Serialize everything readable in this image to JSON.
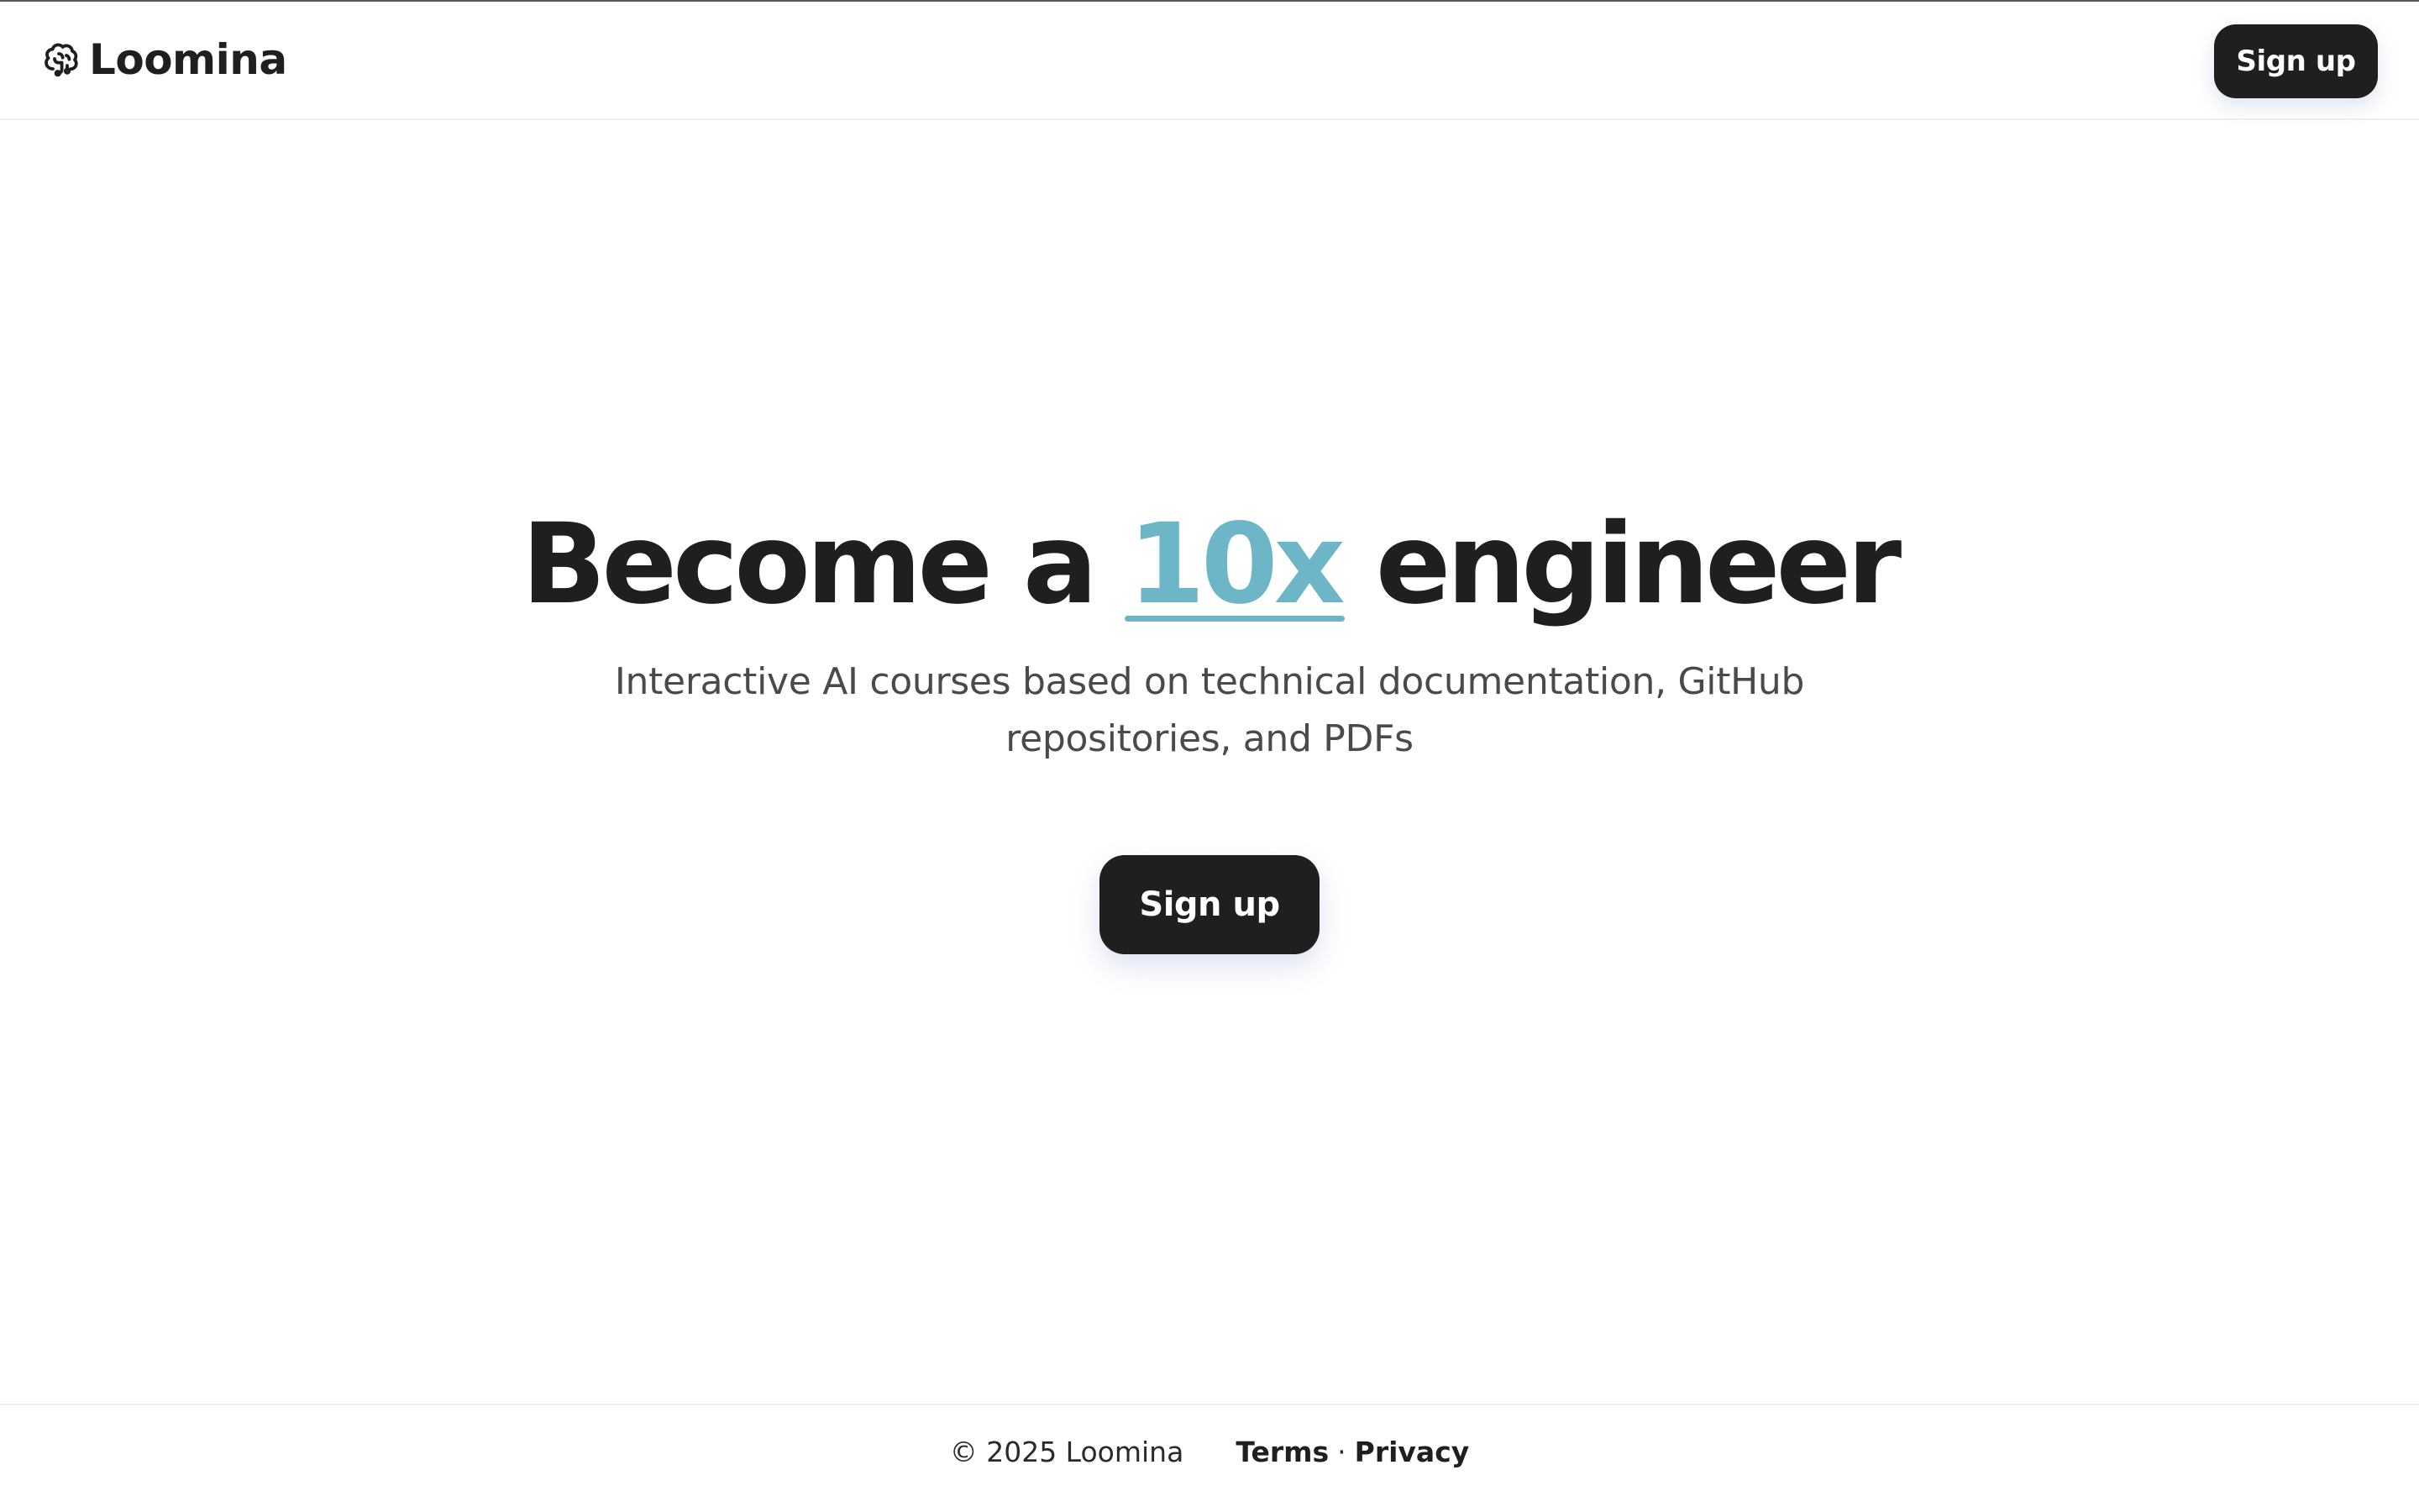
{
  "header": {
    "brand_name": "Loomina",
    "brand_icon": "brain-icon",
    "signup_label": "Sign up"
  },
  "hero": {
    "title_before": "Become a ",
    "title_accent": "10x",
    "title_after": " engineer",
    "subtitle": "Interactive AI courses based on technical documentation, GitHub repositories, and PDFs",
    "signup_label": "Sign up"
  },
  "footer": {
    "copyright": "© 2025 Loomina",
    "terms_label": "Terms",
    "separator": "·",
    "privacy_label": "Privacy"
  },
  "colors": {
    "text": "#1f1f1f",
    "accent": "#6db6c8",
    "button_bg": "#1f1f1f",
    "button_text": "#ffffff",
    "subtitle": "#4a4a4a"
  }
}
